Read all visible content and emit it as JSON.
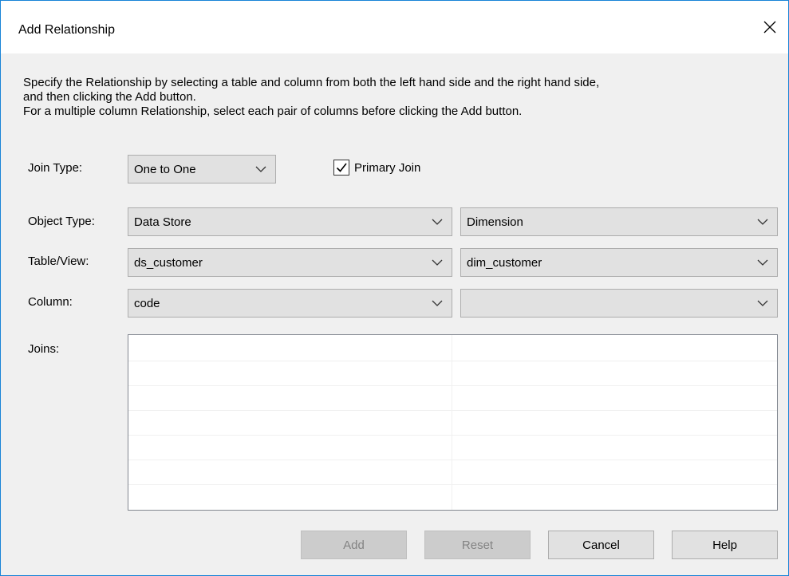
{
  "window": {
    "title": "Add Relationship"
  },
  "description": {
    "line1": "Specify the Relationship by selecting a table and column from both the left hand side and the right hand side,",
    "line2": "and then clicking the Add button.",
    "line3": "For a multiple column Relationship, select each pair of columns before clicking the Add button."
  },
  "join_type": {
    "label": "Join Type:",
    "value": "One to One"
  },
  "primary_join": {
    "label": "Primary Join",
    "checked": true
  },
  "object_type": {
    "label": "Object Type:",
    "left_value": "Data Store",
    "right_value": "Dimension"
  },
  "table_view": {
    "label": "Table/View:",
    "left_value": "ds_customer",
    "right_value": "dim_customer"
  },
  "column": {
    "label": "Column:",
    "left_value": "code",
    "right_value": ""
  },
  "joins": {
    "label": "Joins:",
    "rows": []
  },
  "buttons": {
    "add": "Add",
    "reset": "Reset",
    "cancel": "Cancel",
    "help": "Help"
  },
  "icons": {
    "close": "close-icon",
    "dropdown": "chevron-down-icon",
    "check": "checkmark-icon"
  }
}
